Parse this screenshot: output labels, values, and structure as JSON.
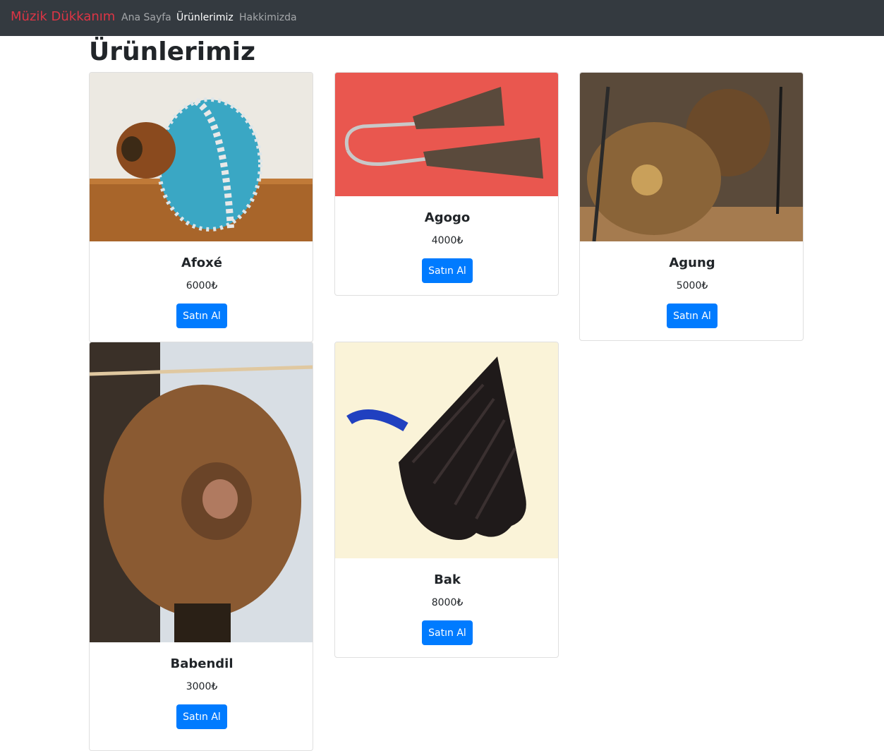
{
  "navbar": {
    "brand": "Müzik Dükkanım",
    "links": [
      "Ana Sayfa",
      "Ürünlerimiz",
      "Hakkimizda"
    ]
  },
  "page": {
    "title": "Ürünlerimiz"
  },
  "products": [
    {
      "name": "Afoxé",
      "price": "6000₺",
      "buy_label": "Satın Al"
    },
    {
      "name": "Agogo",
      "price": "4000₺",
      "buy_label": "Satın Al"
    },
    {
      "name": "Agung",
      "price": "5000₺",
      "buy_label": "Satın Al"
    },
    {
      "name": "Babendil",
      "price": "3000₺",
      "buy_label": "Satın Al"
    },
    {
      "name": "Bak",
      "price": "8000₺",
      "buy_label": "Satın Al"
    }
  ],
  "colors": {
    "navbar_bg": "#343a40",
    "brand": "#dc3545",
    "button": "#007bff"
  }
}
